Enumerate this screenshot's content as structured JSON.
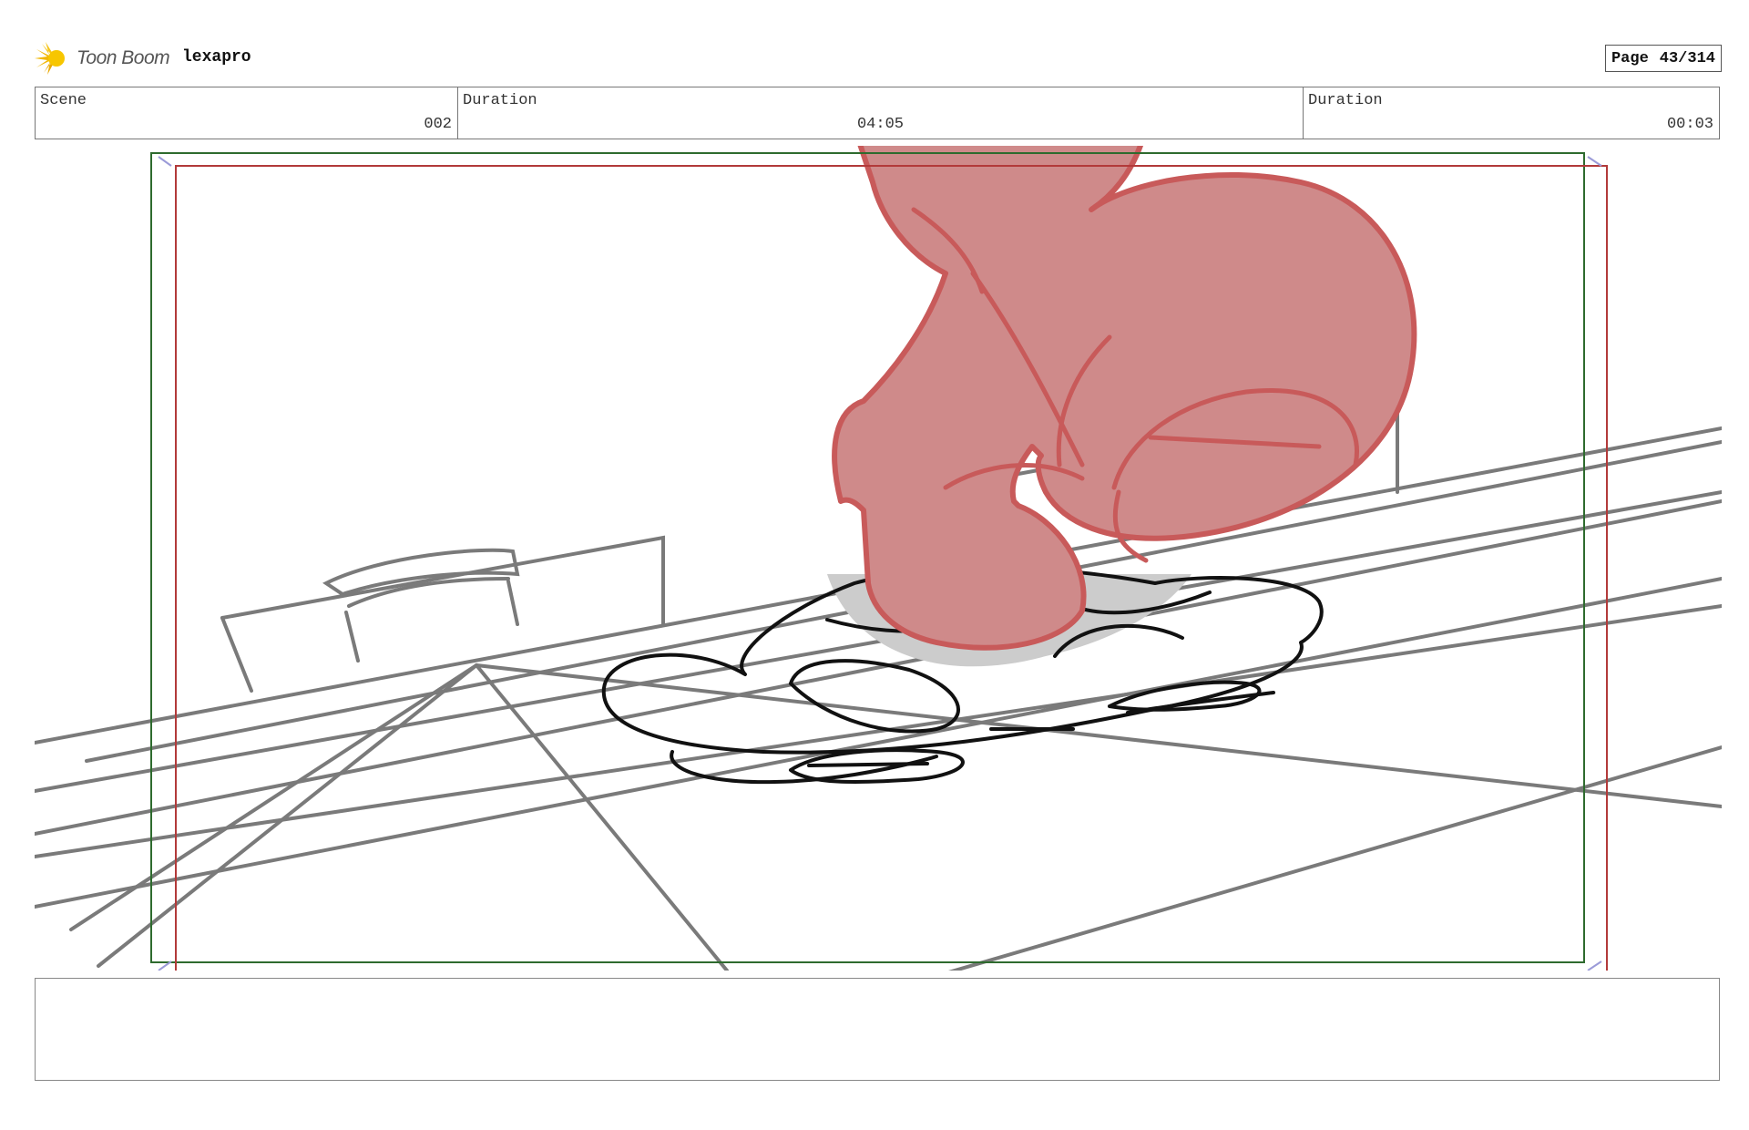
{
  "header": {
    "brand": "Toon Boom",
    "project_name": "lexapro",
    "page_label": "Page",
    "page_number": "43/314"
  },
  "info": {
    "scene_label": "Scene",
    "scene_value": "002",
    "duration_label": "Duration",
    "duration_value": "04:05",
    "panel_duration_label": "Duration",
    "panel_duration_value": "00:03"
  },
  "colors": {
    "safe_area_green": "#2e6b2e",
    "frame_red": "#b23a3a",
    "character_fill": "#cf8a8a",
    "character_stroke": "#c85a5a",
    "construction_gray": "#7a7a7a",
    "ink_black": "#111111"
  },
  "notes": {
    "text": ""
  }
}
